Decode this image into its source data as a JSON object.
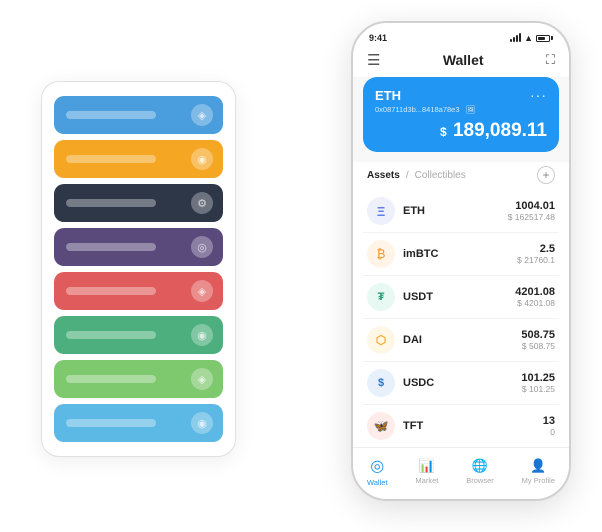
{
  "scene": {
    "card_stack": {
      "cards": [
        {
          "color": "card-blue",
          "icon": "◈"
        },
        {
          "color": "card-orange",
          "icon": "◉"
        },
        {
          "color": "card-dark",
          "icon": "⚙"
        },
        {
          "color": "card-purple",
          "icon": "◎"
        },
        {
          "color": "card-red",
          "icon": "◈"
        },
        {
          "color": "card-green",
          "icon": "◉"
        },
        {
          "color": "card-light-green",
          "icon": "◈"
        },
        {
          "color": "card-light-blue",
          "icon": "◉"
        }
      ]
    },
    "phone": {
      "status_bar": {
        "time": "9:41",
        "battery": "100"
      },
      "top_nav": {
        "menu_icon": "☰",
        "title": "Wallet",
        "expand_icon": "⛶"
      },
      "eth_card": {
        "ticker": "ETH",
        "address": "0x08711d3b...8418a78e3",
        "nft_badge": "🖼",
        "dots": "···",
        "dollar_sign": "$",
        "balance": "189,089.11"
      },
      "assets_section": {
        "tab_active": "Assets",
        "tab_slash": "/",
        "tab_inactive": "Collectibles",
        "add_label": "+"
      },
      "assets": [
        {
          "name": "ETH",
          "icon_color": "#627eea",
          "icon_text": "Ξ",
          "amount": "1004.01",
          "usd": "$ 162517.48"
        },
        {
          "name": "imBTC",
          "icon_color": "#f7931a",
          "icon_text": "₿",
          "amount": "2.5",
          "usd": "$ 21760.1"
        },
        {
          "name": "USDT",
          "icon_color": "#26a17b",
          "icon_text": "₮",
          "amount": "4201.08",
          "usd": "$ 4201.08"
        },
        {
          "name": "DAI",
          "icon_color": "#f5ac37",
          "icon_text": "◈",
          "amount": "508.75",
          "usd": "$ 508.75"
        },
        {
          "name": "USDC",
          "icon_color": "#2775ca",
          "icon_text": "$",
          "amount": "101.25",
          "usd": "$ 101.25"
        },
        {
          "name": "TFT",
          "icon_color": "#e05c5c",
          "icon_text": "🦋",
          "amount": "13",
          "usd": "0"
        }
      ],
      "bottom_nav": [
        {
          "label": "Wallet",
          "icon": "◎",
          "active": true
        },
        {
          "label": "Market",
          "icon": "📈",
          "active": false
        },
        {
          "label": "Browser",
          "icon": "🌐",
          "active": false
        },
        {
          "label": "My Profile",
          "icon": "👤",
          "active": false
        }
      ]
    }
  }
}
